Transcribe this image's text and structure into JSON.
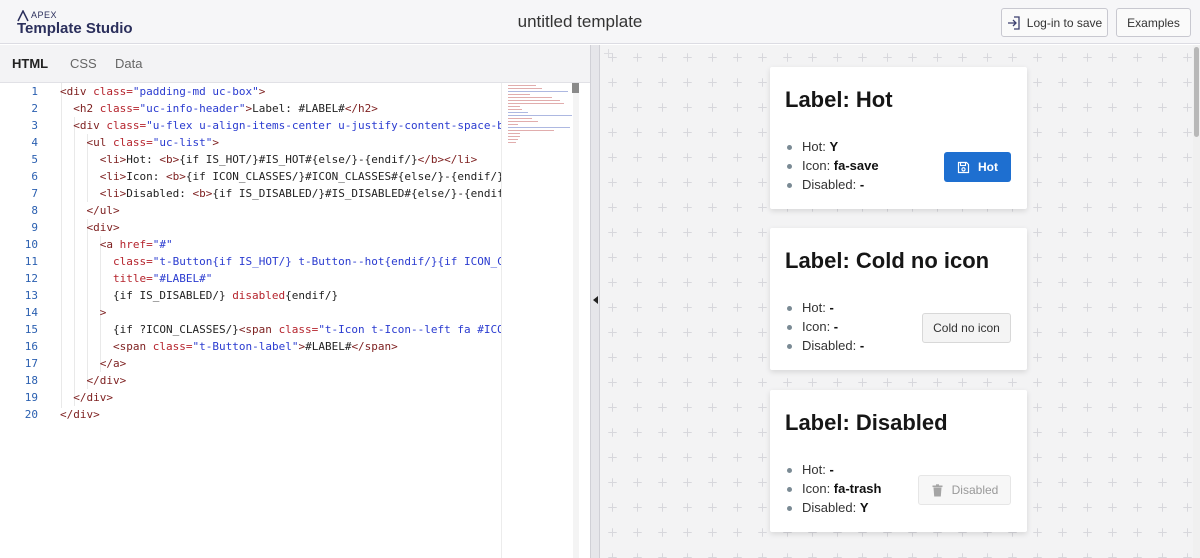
{
  "app": {
    "logo_small": "APEX",
    "logo_name": "Template Studio",
    "title": "untitled template",
    "login_label": "Log-in to save",
    "examples_label": "Examples"
  },
  "editor": {
    "tabs": [
      {
        "label": "HTML",
        "active": true
      },
      {
        "label": "CSS",
        "active": false
      },
      {
        "label": "Data",
        "active": false
      }
    ],
    "line_numbers": [
      "1",
      "2",
      "3",
      "4",
      "5",
      "6",
      "7",
      "8",
      "9",
      "10",
      "11",
      "12",
      "13",
      "14",
      "15",
      "16",
      "17",
      "18",
      "19",
      "20"
    ]
  },
  "preview": {
    "cards": [
      {
        "title": "Label: Hot",
        "hot_label": "Hot: ",
        "hot_value": "Y",
        "icon_label": "Icon: ",
        "icon_value": "fa-save",
        "disabled_label": "Disabled: ",
        "disabled_value": "-",
        "button_label": "Hot",
        "button_icon": "save-icon"
      },
      {
        "title": "Label: Cold no icon",
        "hot_label": "Hot: ",
        "hot_value": "-",
        "icon_label": "Icon: ",
        "icon_value": "-",
        "disabled_label": "Disabled: ",
        "disabled_value": "-",
        "button_label": "Cold no icon"
      },
      {
        "title": "Label: Disabled",
        "hot_label": "Hot: ",
        "hot_value": "-",
        "icon_label": "Icon: ",
        "icon_value": "fa-trash",
        "disabled_label": "Disabled: ",
        "disabled_value": "Y",
        "button_label": "Disabled",
        "button_icon": "trash-icon"
      }
    ]
  },
  "colors": {
    "accent": "#1e6fd0",
    "brand": "#2b2f5c",
    "tag": "#7d1f1f",
    "attr": "#b5232c",
    "string": "#2a3bd0"
  }
}
